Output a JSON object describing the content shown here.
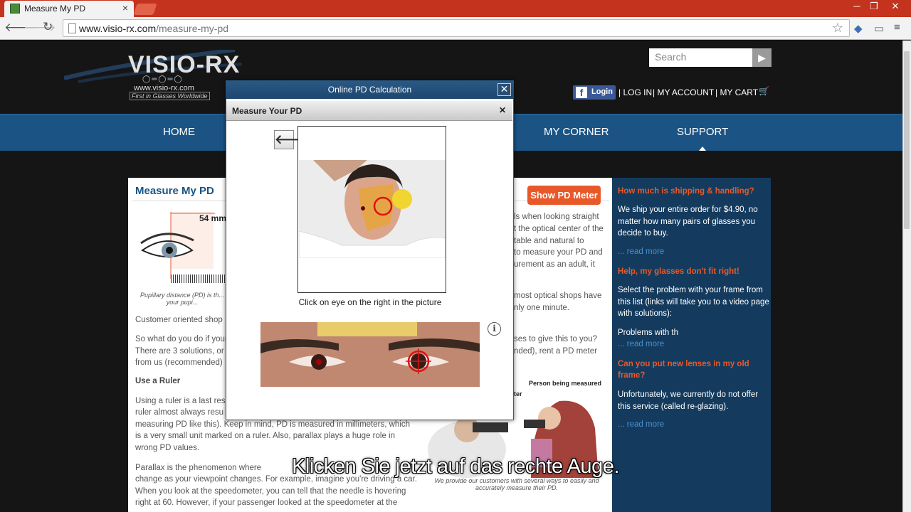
{
  "browser": {
    "tab_title": "Measure My PD",
    "url_domain": "www.visio-rx.com",
    "url_path": "/measure-my-pd",
    "win_min": "─",
    "win_max": "❐",
    "win_close": "✕"
  },
  "site": {
    "logo": "VISIO-RX",
    "logo_url": "www.visio-rx.com",
    "logo_tagline": "First in Glasses Worldwide",
    "search_placeholder": "Search",
    "fb_login": "Login",
    "top_links": [
      "| LOG IN",
      "| MY ACCOUNT",
      "| MY CART"
    ],
    "nav": [
      "HOME",
      "MY CORNER",
      "SUPPORT"
    ]
  },
  "page": {
    "title": "Measure My PD",
    "pd_button": "Show PD Meter",
    "figure_value": "54 mm",
    "figure_caption": "Pupillary distance (PD) is th... your pupi...",
    "para_customer": "Customer oriented shop",
    "para_sowhat": [
      "So what do you do if your",
      "There are 3 solutions, or",
      "from us (recommended)"
    ],
    "heading_ruler": "Use a Ruler",
    "para_ruler": [
      "Using a ruler is a last res",
      "ruler almost always resu",
      "measuring PD like this). Keep in mind, PD is measured in millimeters, which",
      "is a very small unit marked on a ruler. Also, parallax plays a huge role in",
      "wrong PD values."
    ],
    "para_parallax": [
      "Parallax is the phenomenon where",
      "change as your viewpoint changes. For example, imagine you're driving a car.",
      "When you look at the speedometer, you can tell that the needle is hovering",
      "right at 60. However, if your passenger looked at the speedometer at the"
    ],
    "right_col": [
      "ls when looking straight",
      "t the optical center of the",
      "table and natural to",
      "to measure your PD and",
      "urement as an adult, it"
    ],
    "right_col2": [
      "most optical shops have",
      "nly one minute."
    ],
    "right_col3": [
      "ses to give this to you?",
      "nded), rent a PD meter"
    ],
    "illus_person": "Person being measured",
    "illus_meter": "eter",
    "illus_caption": "We provide our customers with several ways to easily and accurately measure their PD."
  },
  "sidebar": {
    "q1": "How much is shipping & handling?",
    "a1": [
      "We ship your entire order for $4.90, no",
      "matter how many pairs of glasses you",
      "decide to buy."
    ],
    "more": "... read more",
    "q2": "Help, my glasses don't fit right!",
    "a2": [
      "Select the problem with your frame from",
      "this list (links will take you to a video page",
      "with solutions):"
    ],
    "a2b": "Problems with th",
    "q3": [
      "Can you put new lenses in my old",
      "frame?"
    ],
    "a3": [
      "Unfortunately, we currently do not offer",
      "this service (called re-glazing)."
    ]
  },
  "modal": {
    "header": "Online PD Calculation",
    "close": "✕",
    "sub_title": "Measure Your PD",
    "sub_close": "✕",
    "back": "🡐",
    "instruction": "Click on eye on the right in the picture",
    "info": "i"
  },
  "subtitle": "Klicken Sie jetzt auf das rechte Auge.",
  "colors": {
    "nav_bar": "#1b5484",
    "accent": "#e8592a",
    "sidebar": "#143b5e",
    "tab_bar": "#c4331d"
  }
}
